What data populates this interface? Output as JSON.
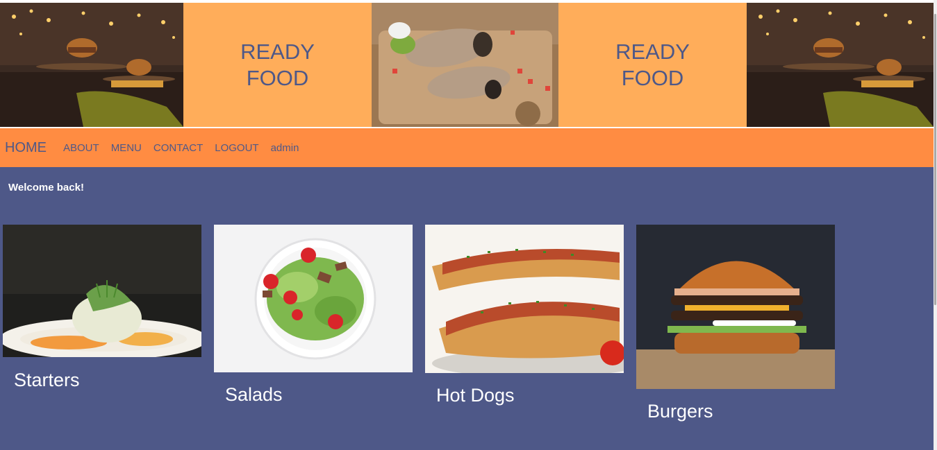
{
  "banner": {
    "brand_1": "READY\nFOOD",
    "brand_2": "READY\nFOOD"
  },
  "nav": {
    "home": "HOME",
    "about": "ABOUT",
    "menu": "MENU",
    "contact": "CONTACT",
    "logout": "LOGOUT",
    "user": "admin"
  },
  "welcome": "Welcome back!",
  "categories": [
    {
      "label": "Starters"
    },
    {
      "label": "Salads"
    },
    {
      "label": "Hot Dogs"
    },
    {
      "label": "Burgers"
    }
  ],
  "colors": {
    "page_bg": "#4e5888",
    "banner_orange": "#ffad5a",
    "nav_orange": "#ff8c42",
    "text_blue": "#4e5888",
    "white": "#ffffff"
  }
}
